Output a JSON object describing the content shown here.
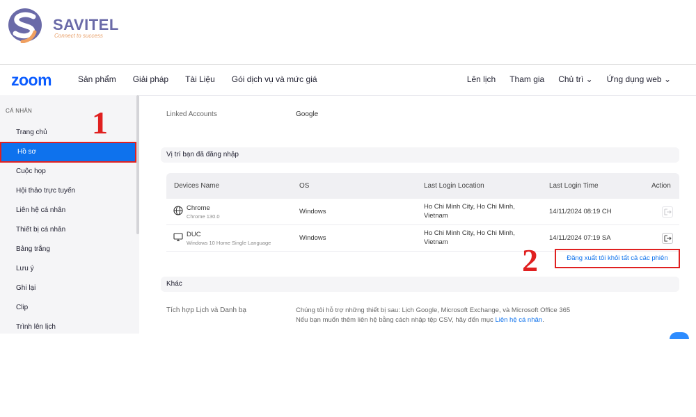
{
  "brand": {
    "name": "SAVITEL",
    "tagline": "Connect to success"
  },
  "topnav": {
    "logo": "zoom",
    "left_items": [
      "Sản phẩm",
      "Giải pháp",
      "Tài Liệu",
      "Gói dịch vụ và mức giá"
    ],
    "right_items": [
      "Lên lịch",
      "Tham gia",
      "Chủ trì",
      "Ứng dụng web"
    ]
  },
  "sidebar": {
    "section": "CÁ NHÂN",
    "items": [
      "Trang chủ",
      "Hồ sơ",
      "Cuộc họp",
      "Hội thảo trực tuyến",
      "Liên hệ cá nhân",
      "Thiết bị cá nhân",
      "Bảng trắng",
      "Lưu ý",
      "Ghi lại",
      "Clip",
      "Trình lên lịch"
    ],
    "active_index": 1
  },
  "linked_accounts": {
    "label": "Linked Accounts",
    "value": "Google"
  },
  "login_section": {
    "title": "Vị trí bạn đã đăng nhập",
    "columns": [
      "Devices Name",
      "OS",
      "Last Login Location",
      "Last Login Time",
      "Action"
    ],
    "rows": [
      {
        "device": "Chrome",
        "device_sub": "Chrome 130.0",
        "os": "Windows",
        "location": "Ho Chi Minh City, Ho Chi Minh, Vietnam",
        "time": "14/11/2024 08:19 CH",
        "icon": "globe-icon"
      },
      {
        "device": "DUC",
        "device_sub": "Windows 10 Home Single Language",
        "os": "Windows",
        "location": "Ho Chi Minh City, Ho Chi Minh, Vietnam",
        "time": "14/11/2024 07:19 SA",
        "icon": "monitor-icon"
      }
    ],
    "logout_all": "Đăng xuất tôi khỏi tất cả các phiên"
  },
  "other_section": {
    "title": "Khác",
    "row_label": "Tích hợp Lịch và Danh bạ",
    "line1": "Chúng tôi hỗ trợ những thiết bị sau: Lịch Google, Microsoft Exchange, và Microsoft Office 365",
    "line2_prefix": "Nếu bạn muốn thêm liên hệ bằng cách nhập tệp CSV, hãy đến mục ",
    "line2_link": "Liên hệ cá nhân",
    "line2_suffix": "."
  },
  "annotations": {
    "step1": "1",
    "step2": "2"
  },
  "colors": {
    "zoom_blue": "#0b5cff",
    "active_blue": "#0e72ed",
    "highlight_red": "#e02020"
  }
}
